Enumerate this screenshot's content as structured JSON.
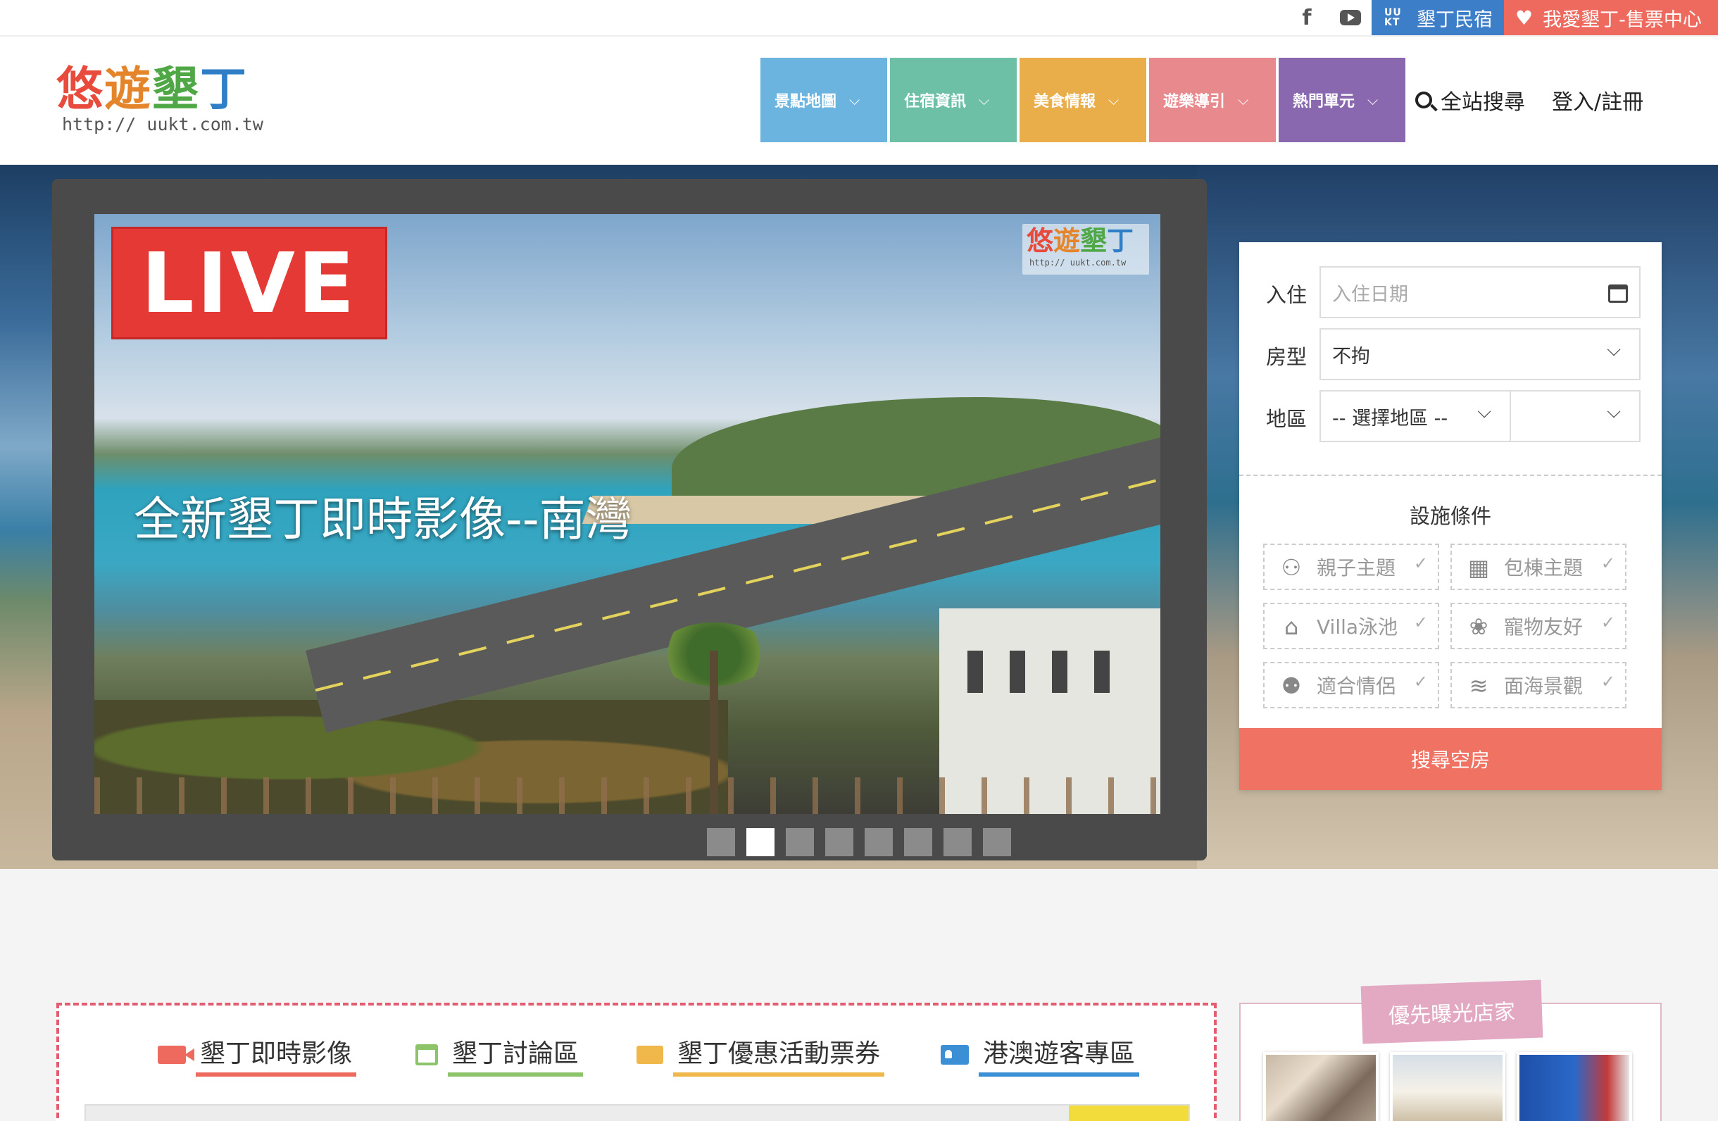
{
  "topbar": {
    "facebook_icon": "facebook-icon",
    "youtube_icon": "youtube-icon",
    "minsu_badge": "UU KT",
    "minsu_label": "墾丁民宿",
    "ticket_label": "我愛墾丁-售票中心"
  },
  "logo": {
    "chars": [
      "悠",
      "遊",
      "墾",
      "丁"
    ],
    "url": "http:// uukt.com.tw",
    "colors": [
      "#e84a3c",
      "#e5852b",
      "#4fa845",
      "#2f7fc7"
    ]
  },
  "nav": {
    "items": [
      {
        "label": "景點地圖",
        "color": "#6cb4e0"
      },
      {
        "label": "住宿資訊",
        "color": "#6dc0a6"
      },
      {
        "label": "美食情報",
        "color": "#e9ad4a"
      },
      {
        "label": "遊樂導引",
        "color": "#e8898e"
      },
      {
        "label": "熱門單元",
        "color": "#8968b0"
      }
    ],
    "chevron": "⌵",
    "search_label": "全站搜尋",
    "login_label": "登入/註冊"
  },
  "hero": {
    "live_label": "LIVE",
    "watermark_url": "http:// uukt.com.tw",
    "caption": "全新墾丁即時影像--南灣",
    "slide_count": 8,
    "active_slide": 2
  },
  "booking": {
    "checkin_label": "入住",
    "checkin_placeholder": "入住日期",
    "roomtype_label": "房型",
    "roomtype_value": "不拘",
    "region_label": "地區",
    "region_value": "-- 選擇地區 --",
    "facilities_title": "設施條件",
    "facilities": [
      {
        "label": "親子主題",
        "icon": "family-icon"
      },
      {
        "label": "包棟主題",
        "icon": "building-icon"
      },
      {
        "label": "Villa泳池",
        "icon": "villa-pool-icon"
      },
      {
        "label": "寵物友好",
        "icon": "paw-icon"
      },
      {
        "label": "適合情侶",
        "icon": "couple-icon"
      },
      {
        "label": "面海景觀",
        "icon": "sea-view-icon"
      }
    ],
    "submit_label": "搜尋空房"
  },
  "tabs": [
    {
      "label": "墾丁即時影像",
      "icon": "video-camera-icon"
    },
    {
      "label": "墾丁討論區",
      "icon": "calendar-icon"
    },
    {
      "label": "墾丁優惠活動票券",
      "icon": "ticket-icon"
    },
    {
      "label": "港澳遊客專區",
      "icon": "id-card-icon"
    }
  ],
  "promo": {
    "label": "優先曝光店家"
  }
}
